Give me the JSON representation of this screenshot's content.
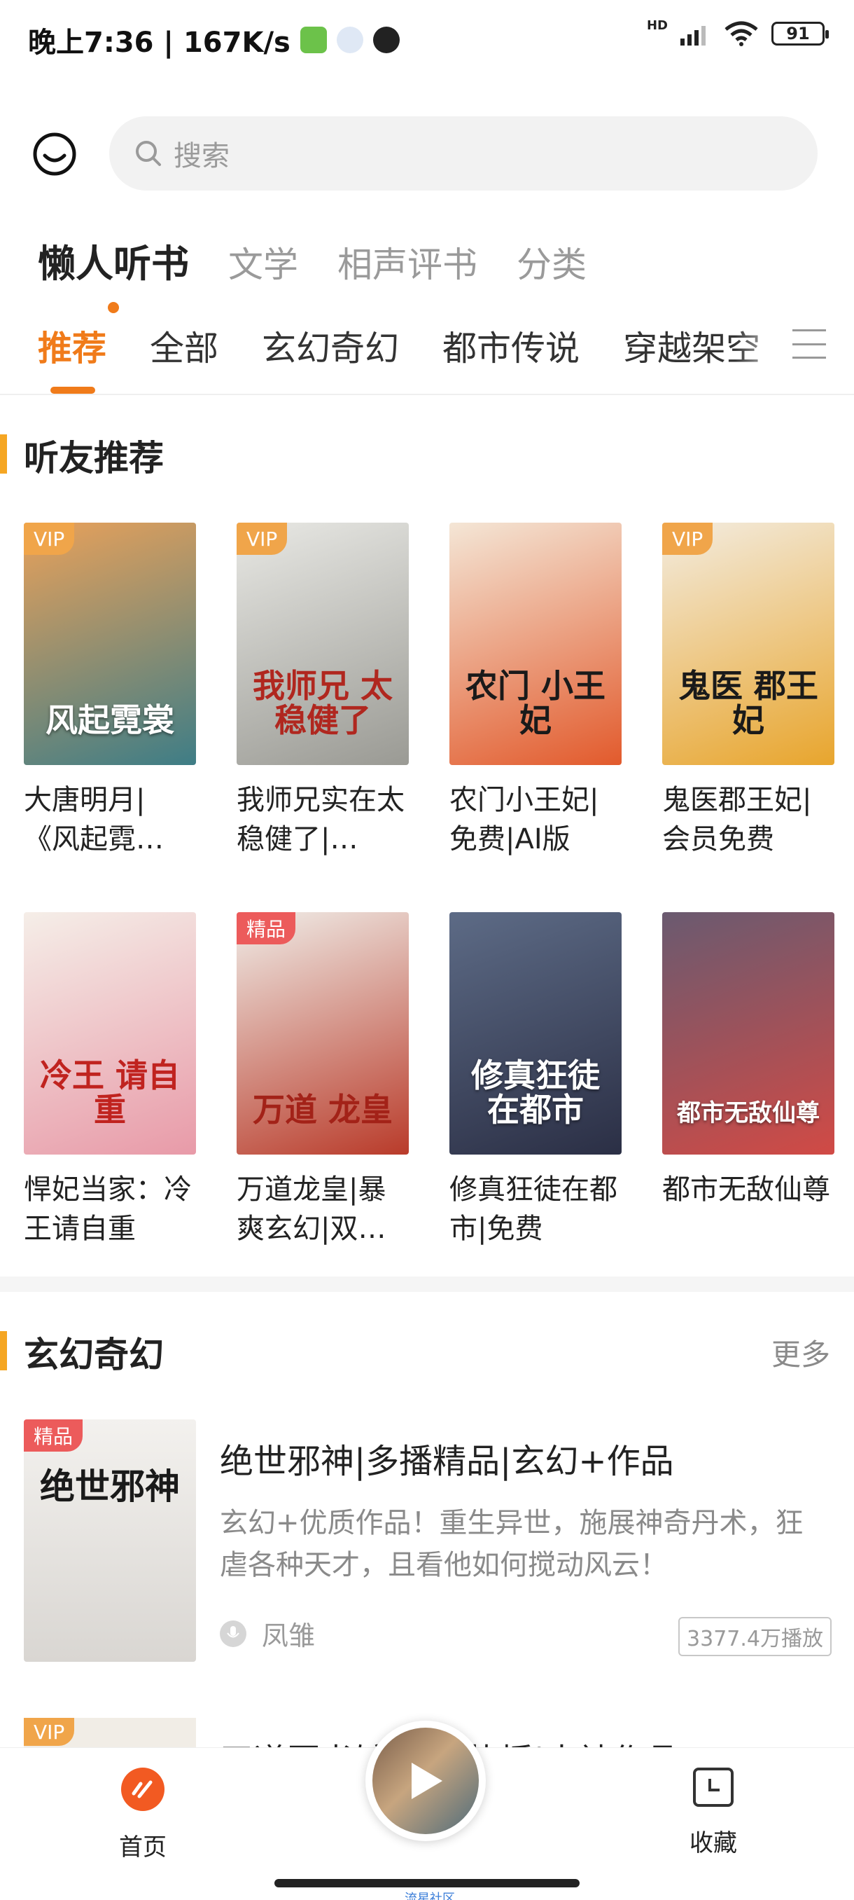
{
  "status_bar": {
    "time_speed": "晚上7:36 | 167K/s",
    "battery": "91",
    "network": "HD"
  },
  "search": {
    "placeholder": "搜索"
  },
  "top_tabs": [
    {
      "label": "懒人听书",
      "active": true
    },
    {
      "label": "文学",
      "active": false
    },
    {
      "label": "相声评书",
      "active": false
    },
    {
      "label": "分类",
      "active": false
    }
  ],
  "category_tabs": [
    {
      "label": "推荐",
      "active": true
    },
    {
      "label": "全部",
      "active": false
    },
    {
      "label": "玄幻奇幻",
      "active": false
    },
    {
      "label": "都市传说",
      "active": false
    },
    {
      "label": "穿越架空",
      "active": false
    }
  ],
  "section_recommend": {
    "title": "听友推荐"
  },
  "books": [
    {
      "name": "大唐明月|《风起霓…",
      "badge": "VIP",
      "cover_text": "风起霓裳",
      "colors": [
        "#e9a15a",
        "#3e7d86"
      ]
    },
    {
      "name": "我师兄实在太稳健了|…",
      "badge": "VIP",
      "cover_text": "我师兄 太稳健了",
      "colors": [
        "#e8e8e4",
        "#9a9a94"
      ]
    },
    {
      "name": "农门小王妃|免费|AI版",
      "badge": "",
      "cover_text": "农门 小王妃",
      "colors": [
        "#f4e6d6",
        "#e25a2c"
      ]
    },
    {
      "name": "鬼医郡王妃|会员免费",
      "badge": "VIP",
      "cover_text": "鬼医 郡王妃",
      "colors": [
        "#f3ece0",
        "#e8a52d"
      ]
    },
    {
      "name": "悍妃当家：冷王请自重",
      "badge": "",
      "cover_text": "冷王 请自重",
      "colors": [
        "#f5eee8",
        "#e89aa8"
      ]
    },
    {
      "name": "万道龙皇|暴爽玄幻|双…",
      "badge": "精品",
      "cover_text": "万道 龙皇",
      "colors": [
        "#f0ede8",
        "#b93b2a"
      ]
    },
    {
      "name": "修真狂徒在都市|免费",
      "badge": "",
      "cover_text": "修真狂徒 在都市",
      "colors": [
        "#5d6b86",
        "#2b2f45"
      ]
    },
    {
      "name": "都市无敌仙尊",
      "badge": "",
      "cover_text": "都市无敌仙尊",
      "colors": [
        "#6a5a70",
        "#d14a45"
      ]
    }
  ],
  "section_fantasy": {
    "title": "玄幻奇幻",
    "more": "更多"
  },
  "list_item": {
    "badge": "精品",
    "cover_text": "绝世邪神",
    "title": "绝世邪神|多播精品|玄幻+作品",
    "desc": "玄幻+优质作品！重生异世，施展神奇丹术，狂虐各种天才，且看他如何搅动风云！",
    "anchor": "凤雏",
    "plays": "3377.4万播放"
  },
  "list_item_2": {
    "badge": "VIP",
    "title": "天道图书馆|…温热播|大神作品"
  },
  "bottom_nav": {
    "home": "首页",
    "favorites": "收藏",
    "community": "流星社区"
  },
  "colors": {
    "accent": "#f07b1a",
    "vip": "#f0a54a",
    "jingpin": "#ec5b5b"
  },
  "icons": [
    "smiley-icon",
    "search-icon",
    "menu-icon",
    "home-icon",
    "play-icon",
    "favorites-icon",
    "microphone-icon"
  ]
}
